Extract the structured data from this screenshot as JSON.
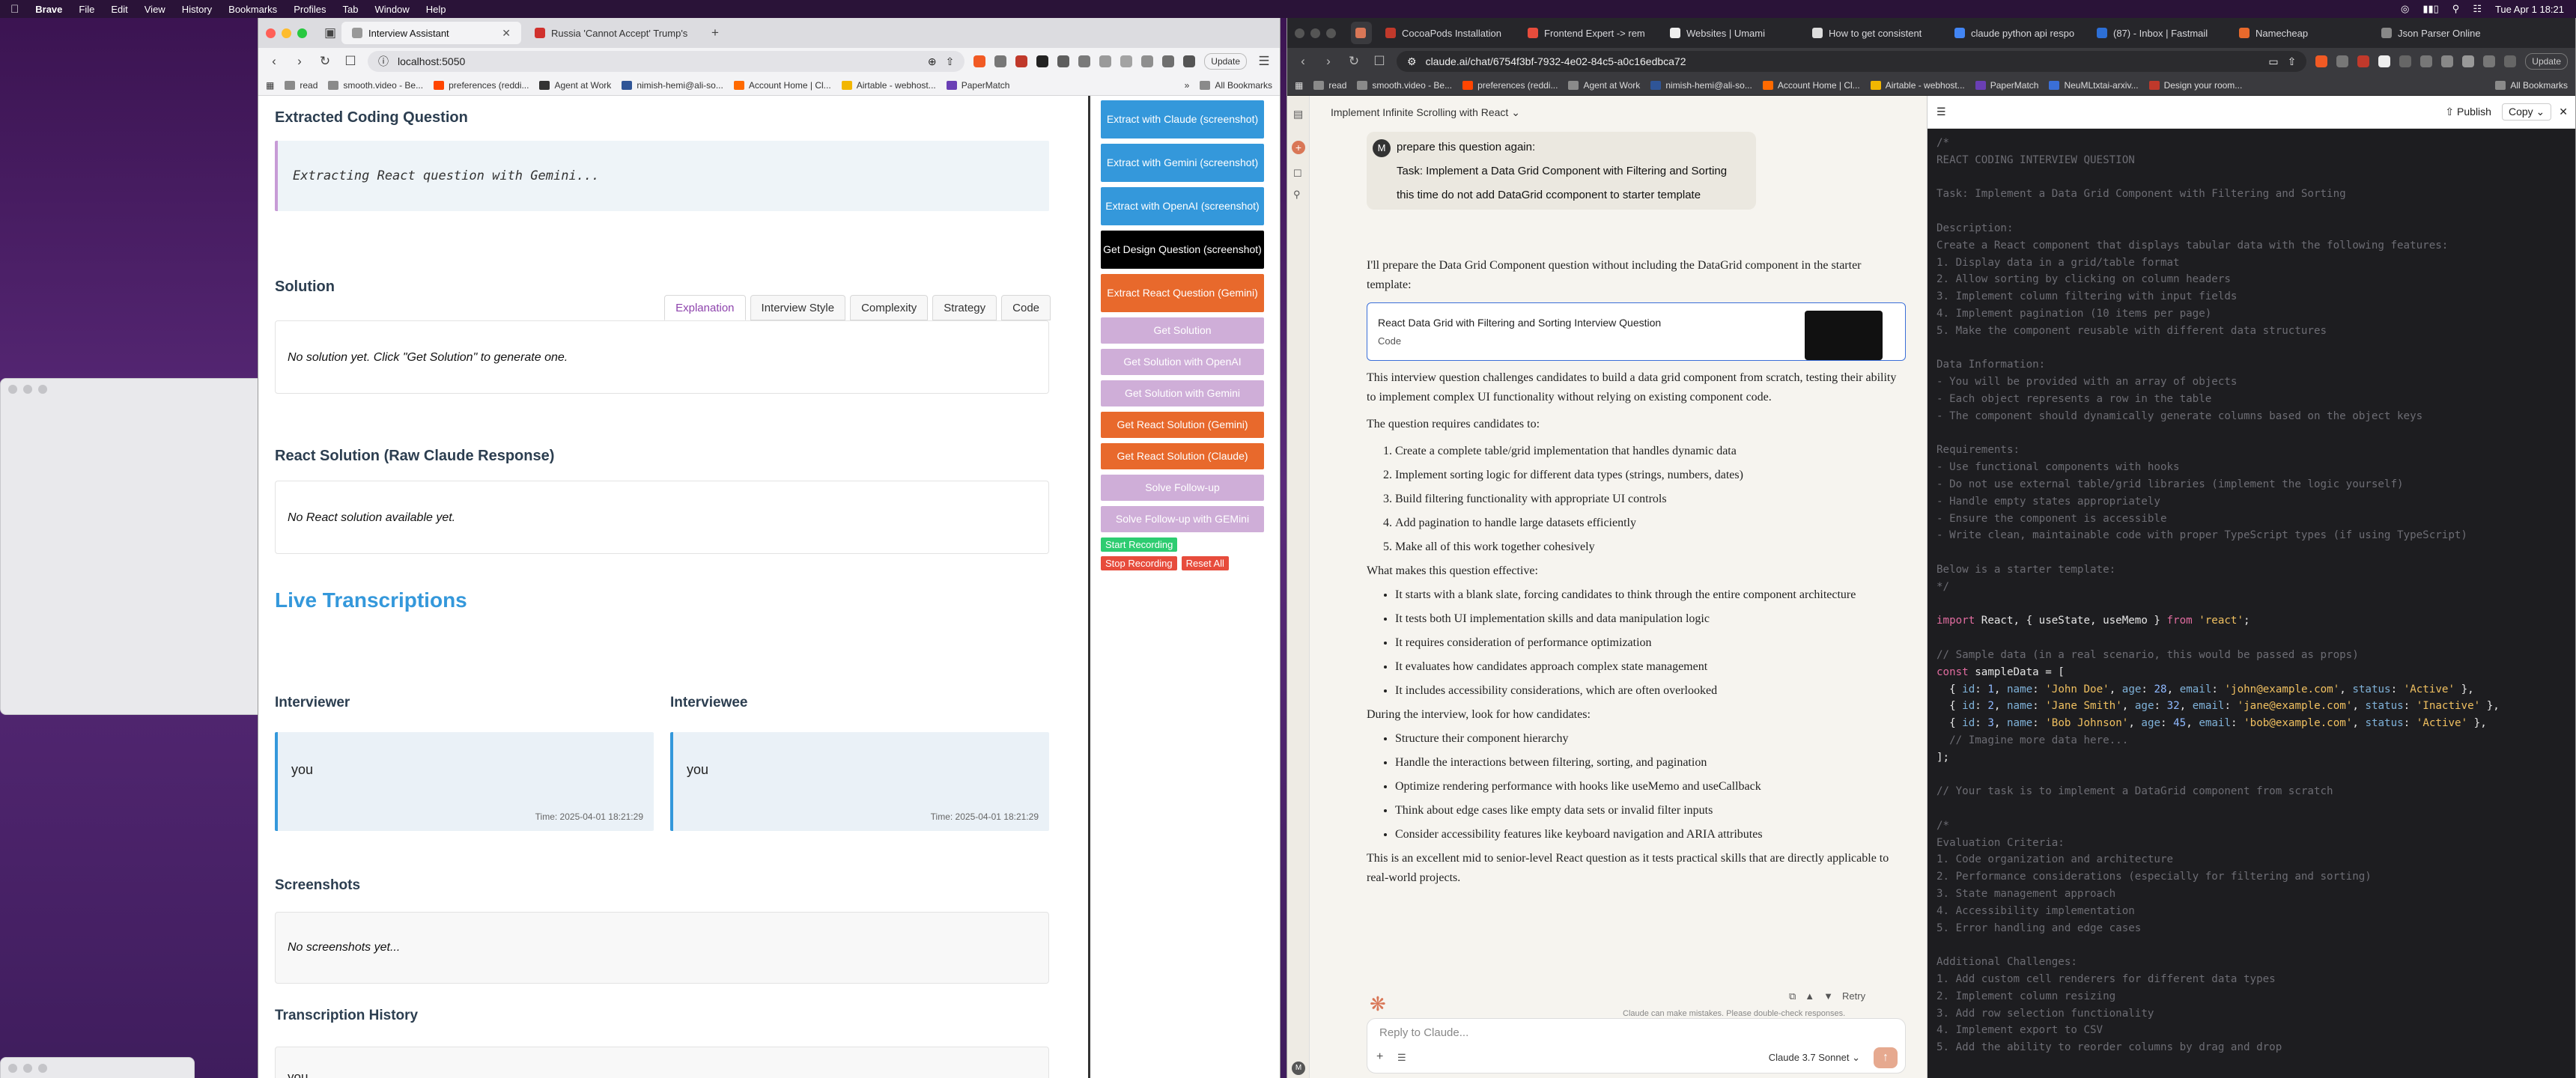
{
  "menubar": {
    "apple": "",
    "app": "Brave",
    "items": [
      "File",
      "Edit",
      "View",
      "History",
      "Bookmarks",
      "Profiles",
      "Tab",
      "Window",
      "Help"
    ],
    "clock": "Tue Apr 1  18:21"
  },
  "left_browser": {
    "tabs": [
      {
        "label": "Interview Assistant",
        "active": true
      },
      {
        "label": "Russia 'Cannot Accept' Trump's",
        "active": false
      }
    ],
    "url": "localhost:5050",
    "update_label": "Update",
    "bookmarks": [
      "read",
      "smooth.video - Be...",
      "preferences (reddi...",
      "Agent at Work",
      "nimish-hemi@ali-so...",
      "Account Home | Cl...",
      "Airtable - webhost...",
      "PaperMatch"
    ],
    "all_bookmarks": "All Bookmarks"
  },
  "app": {
    "extracted_title": "Extracted Coding Question",
    "extracting_text": "Extracting React question with Gemini...",
    "solution_title": "Solution",
    "tabs": [
      "Explanation",
      "Interview Style",
      "Complexity",
      "Strategy",
      "Code"
    ],
    "no_solution": "No solution yet. Click \"Get Solution\" to generate one.",
    "react_title": "React Solution (Raw Claude Response)",
    "no_react": "No React solution available yet.",
    "live_title": "Live Transcriptions",
    "interviewer_title": "Interviewer",
    "interviewee_title": "Interviewee",
    "interviewer_text": "you",
    "interviewee_text": "you",
    "interviewer_time": "Time: 2025-04-01 18:21:29",
    "interviewee_time": "Time: 2025-04-01 18:21:29",
    "screenshots_title": "Screenshots",
    "no_screens": "No screenshots yet...",
    "history_title": "Transcription History",
    "history_text": "you"
  },
  "panel": {
    "buttons": [
      {
        "label": "Extract with Claude (screenshot)",
        "style": "blue"
      },
      {
        "label": "Extract with Gemini (screenshot)",
        "style": "blue"
      },
      {
        "label": "Extract with OpenAI (screenshot)",
        "style": "blue"
      },
      {
        "label": "Get Design Question (screenshot)",
        "style": "black"
      },
      {
        "label": "Extract React Question (Gemini)",
        "style": "orange"
      },
      {
        "label": "Get Solution",
        "style": "lav"
      },
      {
        "label": "Get Solution with OpenAI",
        "style": "lav"
      },
      {
        "label": "Get Solution with Gemini",
        "style": "lav"
      },
      {
        "label": "Get React Solution (Gemini)",
        "style": "orange"
      },
      {
        "label": "Get React Solution (Claude)",
        "style": "orange"
      },
      {
        "label": "Solve Follow-up",
        "style": "lav"
      },
      {
        "label": "Solve Follow-up with GEMini",
        "style": "lav"
      }
    ],
    "start_recording": "Start Recording",
    "stop_recording": "Stop Recording",
    "reset_all": "Reset All",
    "colors": {
      "blue": "#3498db",
      "orange": "#e8692c",
      "lav": "#cfaed8",
      "green": "#2ecc71",
      "red": "#e74c3c"
    }
  },
  "right_browser": {
    "tabs": [
      {
        "label": "CocoaPods Installation"
      },
      {
        "label": "Frontend Expert -> rem"
      },
      {
        "label": "Websites | Umami"
      },
      {
        "label": "How to get consistent"
      },
      {
        "label": "claude python api respo"
      },
      {
        "label": "(87) - Inbox | Fastmail"
      },
      {
        "label": "Namecheap"
      },
      {
        "label": "Json Parser Online"
      }
    ],
    "url": "claude.ai/chat/6754f3bf-7932-4e02-84c5-a0c16edbca72",
    "update_label": "Update",
    "bookmarks": [
      "read",
      "smooth.video - Be...",
      "preferences (reddi...",
      "Agent at Work",
      "nimish-hemi@ali-so...",
      "Account Home | Cl...",
      "Airtable - webhost...",
      "PaperMatch",
      "NeuMLtxtai-arxiv...",
      "Design your room..."
    ],
    "all_bookmarks": "All Bookmarks"
  },
  "claude": {
    "chat_title": "Implement Infinite Scrolling with React",
    "user_avatar": "M",
    "user_lines": [
      "prepare this question again:",
      "Task: Implement a Data Grid Component with Filtering and Sorting",
      "this time do not add DataGrid ccomponent to starter template"
    ],
    "intro": "I'll prepare the Data Grid Component question without including the DataGrid component in the starter template:",
    "artifact_card_title": "React Data Grid with Filtering and Sorting Interview Question",
    "artifact_card_sub": "Code",
    "para1": "This interview question challenges candidates to build a data grid component from scratch, testing their ability to implement complex UI functionality without relying on existing component code.",
    "req_lead": "The question requires candidates to:",
    "reqs": [
      "Create a complete table/grid implementation that handles dynamic data",
      "Implement sorting logic for different data types (strings, numbers, dates)",
      "Build filtering functionality with appropriate UI controls",
      "Add pagination to handle large datasets efficiently",
      "Make all of this work together cohesively"
    ],
    "eff_lead": "What makes this question effective:",
    "effs": [
      "It starts with a blank slate, forcing candidates to think through the entire component architecture",
      "It tests both UI implementation skills and data manipulation logic",
      "It requires consideration of performance optimization",
      "It evaluates how candidates approach complex state management",
      "It includes accessibility considerations, which are often overlooked"
    ],
    "look_lead": "During the interview, look for how candidates:",
    "looks": [
      "Structure their component hierarchy",
      "Handle the interactions between filtering, sorting, and pagination",
      "Optimize rendering performance with hooks like useMemo and useCallback",
      "Think about edge cases like empty data sets or invalid filter inputs",
      "Consider accessibility features like keyboard navigation and ARIA attributes"
    ],
    "closing": "This is an excellent mid to senior-level React question as it tests practical skills that are directly applicable to real-world projects.",
    "retry": "Retry",
    "disclaimer": "Claude can make mistakes. Please double-check responses.",
    "input_placeholder": "Reply to Claude...",
    "model": "Claude 3.7 Sonnet",
    "publish": "Publish",
    "copy": "Copy",
    "accent": "#d97757"
  }
}
